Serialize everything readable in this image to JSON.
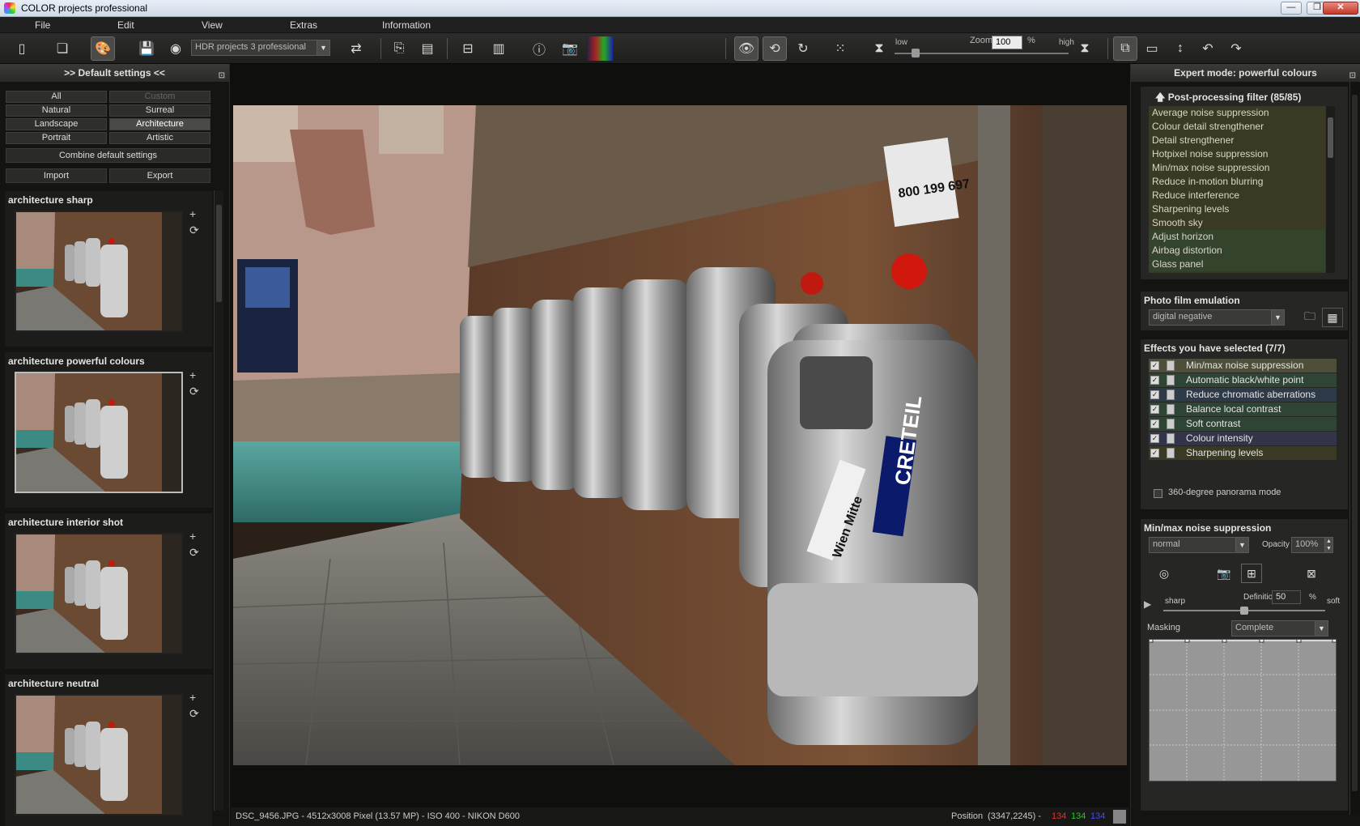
{
  "window": {
    "title": "COLOR projects professional",
    "min": "—",
    "max": "❐",
    "close": "✕"
  },
  "menu": [
    "File",
    "Edit",
    "View",
    "Extras",
    "Information"
  ],
  "toolbar": {
    "preset_combo": "HDR projects 3 professional",
    "zoom_label": "Zoom",
    "zoom_value": "100",
    "zoom_unit": "%",
    "low_label": "low",
    "high_label": "high",
    "icons": [
      "new-file-icon",
      "open-file-icon",
      "palette-icon",
      "save-icon",
      "disc-icon",
      "flow-icon",
      "export-icon",
      "gallery-icon",
      "compare-icon",
      "filmstrip-icon",
      "info-icon",
      "exif-icon",
      "histogram-icon",
      "eye-icon",
      "rotate-ccw-icon",
      "redo-icon",
      "grid-icon",
      "low-icon",
      "high-icon",
      "crop-icon",
      "fit-icon",
      "resize-icon",
      "rotate-left-icon",
      "rotate-right-icon"
    ]
  },
  "left": {
    "header": ">> Default settings <<",
    "pin": "⊡",
    "categories": [
      [
        "All",
        "Custom"
      ],
      [
        "Natural",
        "Surreal"
      ],
      [
        "Landscape",
        "Architecture"
      ],
      [
        "Portrait",
        "Artistic"
      ]
    ],
    "combine": "Combine default settings",
    "import": "Import",
    "export": "Export",
    "presets": [
      {
        "name": "architecture sharp",
        "selected": false
      },
      {
        "name": "architecture powerful colours",
        "selected": true
      },
      {
        "name": "architecture interior shot",
        "selected": false
      },
      {
        "name": "architecture neutral",
        "selected": false
      }
    ],
    "plus": "+",
    "refresh": "⟳"
  },
  "status": {
    "file": "DSC_9456.JPG - 4512x3008 Pixel (13.57 MP)   - ISO 400 - NIKON D600",
    "position_label": "Position",
    "position_value": "(3347,2245) -",
    "r": "134",
    "g": "134",
    "b": "134"
  },
  "right": {
    "header": "Expert mode: powerful colours",
    "pin": "⊡",
    "postproc": {
      "title": "Post-processing filter (85/85)",
      "arrow": "🡅",
      "items": [
        "Average noise suppression",
        "Colour detail strengthener",
        "Detail strengthener",
        "Hotpixel noise suppression",
        "Min/max noise suppression",
        "Reduce in-motion blurring",
        "Reduce interference",
        "Sharpening levels",
        "Smooth sky",
        "Adjust horizon",
        "Airbag distortion",
        "Glass panel"
      ]
    },
    "film": {
      "title": "Photo film emulation",
      "value": "digital negative"
    },
    "effects": {
      "title": "Effects you have selected (7/7)",
      "items": [
        {
          "label": "Min/max noise suppression",
          "color": "#4f4f39"
        },
        {
          "label": "Automatic black/white point",
          "color": "#2e4535"
        },
        {
          "label": "Reduce chromatic aberrations",
          "color": "#2f3a48"
        },
        {
          "label": "Balance local contrast",
          "color": "#2e4535"
        },
        {
          "label": "Soft contrast",
          "color": "#2e4535"
        },
        {
          "label": "Colour intensity",
          "color": "#33344a"
        },
        {
          "label": "Sharpening levels",
          "color": "#3a3924"
        }
      ],
      "panorama": "360-degree panorama mode"
    },
    "minmax": {
      "title": "Min/max noise suppression",
      "mode": "normal",
      "opacity_label": "Opacity",
      "opacity_value": "100%",
      "sharp": "sharp",
      "soft": "soft",
      "definition_label": "Definition",
      "definition_value": "50",
      "definition_unit": "%",
      "definition_level": 0.5,
      "masking_label": "Masking",
      "masking_value": "Complete"
    }
  }
}
